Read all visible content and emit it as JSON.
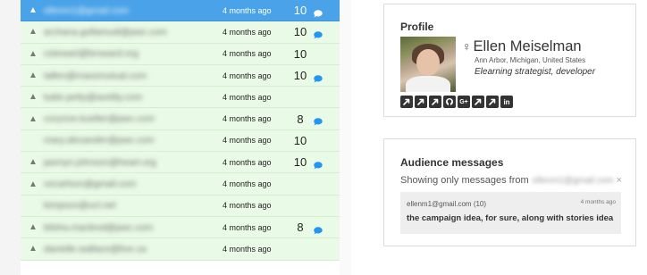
{
  "messages_list": {
    "rows": [
      {
        "email": "ellenm1@gmail.com",
        "time": "4 months ago",
        "count": "10",
        "has_icon": true,
        "has_bubble": true,
        "selected": true
      },
      {
        "email": "archana.gollamudi@pwc.com",
        "time": "4 months ago",
        "count": "10",
        "has_icon": true,
        "has_bubble": true,
        "selected": false
      },
      {
        "email": "cstewart@broward.org",
        "time": "4 months ago",
        "count": "10",
        "has_icon": true,
        "has_bubble": false,
        "selected": false
      },
      {
        "email": "tallen@massmutual.com",
        "time": "4 months ago",
        "count": "10",
        "has_icon": true,
        "has_bubble": true,
        "selected": false
      },
      {
        "email": "katie.petty@avelity.com",
        "time": "4 months ago",
        "count": "",
        "has_icon": true,
        "has_bubble": false,
        "selected": false
      },
      {
        "email": "corynne.kuelter@pwc.com",
        "time": "4 months ago",
        "count": "8",
        "has_icon": true,
        "has_bubble": true,
        "selected": false
      },
      {
        "email": "mary.alexander@pwc.com",
        "time": "4 months ago",
        "count": "10",
        "has_icon": false,
        "has_bubble": false,
        "selected": false
      },
      {
        "email": "jasmyn.johnson@heart.org",
        "time": "4 months ago",
        "count": "10",
        "has_icon": true,
        "has_bubble": true,
        "selected": false
      },
      {
        "email": "cecarlson@gmail.com",
        "time": "4 months ago",
        "count": "",
        "has_icon": true,
        "has_bubble": false,
        "selected": false
      },
      {
        "email": "kimpson@ucl.net",
        "time": "4 months ago",
        "count": "",
        "has_icon": false,
        "has_bubble": false,
        "selected": false
      },
      {
        "email": "bilsha.macleod@pwc.com",
        "time": "4 months ago",
        "count": "8",
        "has_icon": true,
        "has_bubble": true,
        "selected": false
      },
      {
        "email": "danielle.wallace@live.ca",
        "time": "4 months ago",
        "count": "",
        "has_icon": true,
        "has_bubble": false,
        "selected": false
      }
    ]
  },
  "profile": {
    "title": "Profile",
    "gender_symbol": "♀",
    "name": "Ellen Meiselman",
    "location": "Ann Arbor, Michigan, United States",
    "role": "Elearning strategist, developer",
    "social_icons": [
      "external-link-icon",
      "external-link-icon",
      "external-link-icon",
      "github-icon",
      "google-plus-icon",
      "external-link-icon",
      "external-link-icon",
      "linkedin-icon"
    ],
    "google_plus_text": "G+",
    "linkedin_text": "in"
  },
  "audience": {
    "title": "Audience messages",
    "filter_prefix": "Showing only messages from",
    "filter_email": "ellenm1@gmail.com",
    "clear_symbol": "×",
    "message": {
      "sender": "ellenm1@gmail.com (10)",
      "time": "4 months ago",
      "text": "the campaign idea, for sure, along with stories idea"
    }
  },
  "colors": {
    "row_background": "#e9fbe6",
    "selected_row": "#4aa3e8",
    "bubble_icon": "#2196f3",
    "social_icon_bg": "#333333"
  }
}
